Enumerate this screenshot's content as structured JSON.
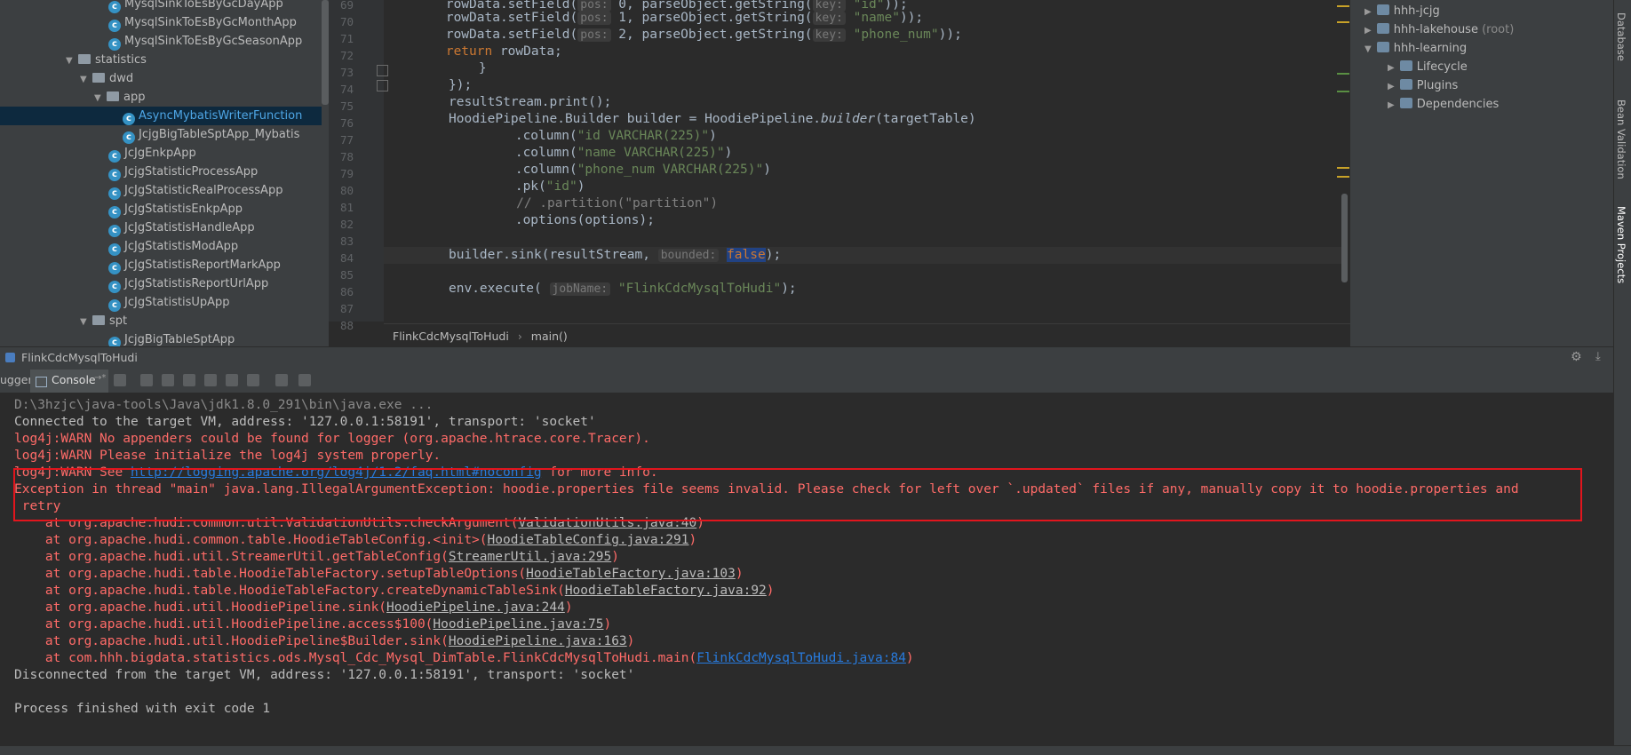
{
  "project_tree": {
    "items": [
      {
        "label": "MysqlSinkToEsByGcDayApp",
        "icon": "class-icon"
      },
      {
        "label": "MysqlSinkToEsByGcMonthApp",
        "icon": "class-icon"
      },
      {
        "label": "MysqlSinkToEsByGcSeasonApp",
        "icon": "class-icon"
      },
      {
        "label": "statistics",
        "icon": "folder-icon"
      },
      {
        "label": "dwd",
        "icon": "folder-icon"
      },
      {
        "label": "app",
        "icon": "folder-icon"
      },
      {
        "label": "AsyncMybatisWriterFunction",
        "icon": "class-icon",
        "selected": true
      },
      {
        "label": "JcjgBigTableSptApp_Mybatis",
        "icon": "class-icon"
      },
      {
        "label": "JcJgEnkpApp",
        "icon": "class-icon"
      },
      {
        "label": "JcjgStatisticProcessApp",
        "icon": "class-icon"
      },
      {
        "label": "JcJgStatisticRealProcessApp",
        "icon": "class-icon"
      },
      {
        "label": "JcJgStatistisEnkpApp",
        "icon": "class-icon"
      },
      {
        "label": "JcJgStatistisHandleApp",
        "icon": "class-icon"
      },
      {
        "label": "JcJgStatistisModApp",
        "icon": "class-icon"
      },
      {
        "label": "JcJgStatistisReportMarkApp",
        "icon": "class-icon"
      },
      {
        "label": "JcJgStatistisReportUrlApp",
        "icon": "class-icon"
      },
      {
        "label": "JcJgStatistisUpApp",
        "icon": "class-icon"
      },
      {
        "label": "spt",
        "icon": "folder-icon"
      },
      {
        "label": "JcjgBigTableSptApp",
        "icon": "class-icon"
      }
    ]
  },
  "editor": {
    "line_numbers": [
      "69",
      "70",
      "71",
      "72",
      "73",
      "74",
      "75",
      "76",
      "77",
      "78",
      "79",
      "80",
      "81",
      "82",
      "83",
      "84",
      "85",
      "86",
      "87",
      "88"
    ],
    "breadcrumb": {
      "file": "FlinkCdcMysqlToHudi",
      "sep": "›",
      "method": "main()"
    },
    "lines": {
      "l69_a": "        rowData.setField(",
      "l69_hint": "pos:",
      "l69_b": " 0, parseObject.getString(",
      "l69_hint2": "key:",
      "l69_str": " \"id\"",
      "l69_c": "));",
      "l70_a": "        rowData.setField(",
      "l70_hint": "pos:",
      "l70_b": " 1, parseObject.getString(",
      "l70_hint2": "key:",
      "l70_str": " \"name\"",
      "l70_c": "));",
      "l71_a": "        rowData.setField(",
      "l71_hint": "pos:",
      "l71_b": " 2, parseObject.getString(",
      "l71_hint2": "key:",
      "l71_str": " \"phone_num\"",
      "l71_c": "));",
      "l72_kw": "        return",
      "l72_b": " rowData;",
      "l73": "    }",
      "l74": "});",
      "l75": "resultStream.print();",
      "l76_a": "HoodiePipeline.Builder builder = HoodiePipeline.",
      "l76_it": "builder",
      "l76_b": "(targetTable)",
      "l77_a": "        .column(",
      "l77_str": "\"id VARCHAR(225)\"",
      "l77_b": ")",
      "l78_a": "        .column(",
      "l78_str": "\"name VARCHAR(225)\"",
      "l78_b": ")",
      "l79_a": "        .column(",
      "l79_str": "\"phone_num VARCHAR(225)\"",
      "l79_b": ")",
      "l80_a": "        .pk(",
      "l80_str": "\"id\"",
      "l80_b": ")",
      "l81": "       // .partition(\"partition\")",
      "l82": "        .options(options);",
      "l84_a": "builder.sink(resultStream, ",
      "l84_hint": "bounded:",
      "l84_sel": "false",
      "l84_b": ");",
      "l86_a": "env.execute( ",
      "l86_hint": "jobName:",
      "l86_str": " \"FlinkCdcMysqlToHudi\"",
      "l86_b": ");"
    }
  },
  "maven_panel": {
    "items": [
      {
        "label": "hhh-jcjg",
        "suffix": ""
      },
      {
        "label": "hhh-lakehouse",
        "suffix": "(root)"
      },
      {
        "label": "hhh-learning",
        "suffix": ""
      },
      {
        "label": "Lifecycle",
        "suffix": ""
      },
      {
        "label": "Plugins",
        "suffix": ""
      },
      {
        "label": "Dependencies",
        "suffix": ""
      }
    ]
  },
  "side_tabs": {
    "database": "Database",
    "bean_validation": "Bean Validation",
    "maven": "Maven Projects"
  },
  "run_panel": {
    "title": "FlinkCdcMysqlToHudi",
    "tab_logger": "ugger",
    "tab_console": "Console",
    "tab_console_suffix": "→*"
  },
  "console": {
    "l1": "D:\\3hzjc\\java-tools\\Java\\jdk1.8.0_291\\bin\\java.exe ...",
    "l2": "Connected to the target VM, address: '127.0.0.1:58191', transport: 'socket'",
    "l3": "log4j:WARN No appenders could be found for logger (org.apache.htrace.core.Tracer).",
    "l4": "log4j:WARN Please initialize the log4j system properly.",
    "l5_a": "log4j:WARN See ",
    "l5_link": "http://logging.apache.org/log4j/1.2/faq.html#noconfig",
    "l5_b": " for more info.",
    "l6": "Exception in thread \"main\" java.lang.IllegalArgumentException: hoodie.properties file seems invalid. Please check for left over `.updated` files if any, manually copy it to hoodie.properties and",
    "l7": " retry",
    "st1_a": "    at org.apache.hudi.common.util.ValidationUtils.checkArgument(",
    "st1_link": "ValidationUtils.java:40",
    "st1_b": ")",
    "st2_a": "    at org.apache.hudi.common.table.HoodieTableConfig.<init>(",
    "st2_link": "HoodieTableConfig.java:291",
    "st2_b": ")",
    "st3_a": "    at org.apache.hudi.util.StreamerUtil.getTableConfig(",
    "st3_link": "StreamerUtil.java:295",
    "st3_b": ")",
    "st4_a": "    at org.apache.hudi.table.HoodieTableFactory.setupTableOptions(",
    "st4_link": "HoodieTableFactory.java:103",
    "st4_b": ")",
    "st5_a": "    at org.apache.hudi.table.HoodieTableFactory.createDynamicTableSink(",
    "st5_link": "HoodieTableFactory.java:92",
    "st5_b": ")",
    "st6_a": "    at org.apache.hudi.util.HoodiePipeline.sink(",
    "st6_link": "HoodiePipeline.java:244",
    "st6_b": ")",
    "st7_a": "    at org.apache.hudi.util.HoodiePipeline.access$100(",
    "st7_link": "HoodiePipeline.java:75",
    "st7_b": ")",
    "st8_a": "    at org.apache.hudi.util.HoodiePipeline$Builder.sink(",
    "st8_link": "HoodiePipeline.java:163",
    "st8_b": ")",
    "st9_a": "    at com.hhh.bigdata.statistics.ods.Mysql_Cdc_Mysql_DimTable.FlinkCdcMysqlToHudi.main(",
    "st9_link": "FlinkCdcMysqlToHudi.java:84",
    "st9_b": ")",
    "l_disc": "Disconnected from the target VM, address: '127.0.0.1:58191', transport: 'socket'",
    "l_exit": "Process finished with exit code 1"
  },
  "colors": {
    "error": "#ff6b68",
    "highlight_box": "#e2151d",
    "link": "#287bde",
    "string": "#6a8759",
    "keyword": "#cc7832"
  }
}
